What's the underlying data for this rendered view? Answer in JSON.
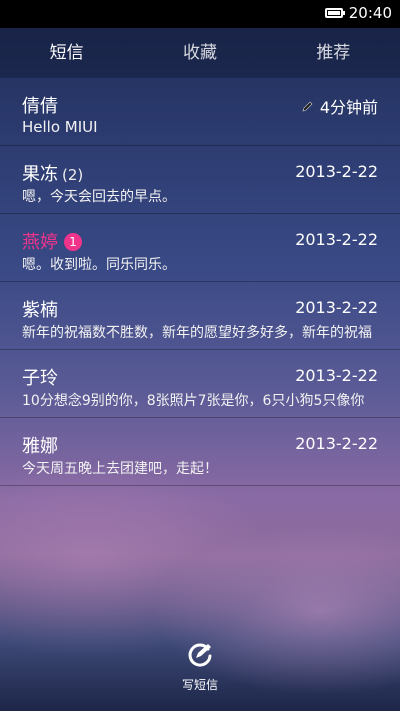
{
  "status_bar": {
    "time": "20:40",
    "battery_icon": "battery-icon",
    "battery_level": 1.0
  },
  "tabs": [
    {
      "label": "短信",
      "active": true
    },
    {
      "label": "收藏",
      "active": false
    },
    {
      "label": "推荐",
      "active": false
    }
  ],
  "conversations": [
    {
      "name": "倩倩",
      "count": "",
      "badge": "",
      "time": "4分钟前",
      "preview": "Hello MIUI",
      "draft_icon": "pencil-icon"
    },
    {
      "name": "果冻",
      "count": "(2)",
      "badge": "",
      "time": "2013-2-22",
      "preview": "嗯，今天会回去的早点。"
    },
    {
      "name": "燕婷",
      "count": "",
      "badge": "1",
      "time": "2013-2-22",
      "preview": "嗯。收到啦。同乐同乐。",
      "unread_color": "#f0348c"
    },
    {
      "name": "紫楠",
      "count": "",
      "badge": "",
      "time": "2013-2-22",
      "preview": "新年的祝福数不胜数，新年的愿望好多好多，新年的祝福"
    },
    {
      "name": "子玲",
      "count": "",
      "badge": "",
      "time": "2013-2-22",
      "preview": "10分想念9别的你，8张照片7张是你，6只小狗5只像你"
    },
    {
      "name": "雅娜",
      "count": "",
      "badge": "",
      "time": "2013-2-22",
      "preview": "今天周五晚上去团建吧，走起！"
    }
  ],
  "compose": {
    "label": "写短信",
    "icon": "compose-icon"
  },
  "colors": {
    "accent": "#f0348c",
    "status_bar": "#000000"
  }
}
